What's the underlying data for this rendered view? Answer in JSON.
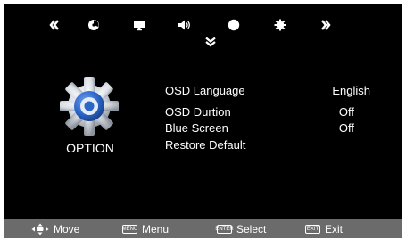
{
  "top_nav": {
    "items": [
      {
        "icon": "chevron-double-left-icon"
      },
      {
        "icon": "picture-mode-icon"
      },
      {
        "icon": "screen-icon"
      },
      {
        "icon": "speaker-icon"
      },
      {
        "icon": "circle-icon"
      },
      {
        "icon": "gear-icon"
      },
      {
        "icon": "chevron-double-right-icon"
      }
    ],
    "down_indicator_icon": "chevron-double-down-icon"
  },
  "category": {
    "label": "OPTION",
    "icon": "gear-icon",
    "icon_color": "#2b66c9"
  },
  "menu": {
    "items": [
      {
        "label": "OSD Language",
        "value": "English"
      },
      {
        "label": "OSD Durtion",
        "value": "Off"
      },
      {
        "label": "Blue Screen",
        "value": "Off"
      },
      {
        "label": "Restore Default",
        "value": ""
      }
    ]
  },
  "bottom_bar": {
    "hints": [
      {
        "key": "",
        "label": "Move",
        "icon": "dpad-icon"
      },
      {
        "key": "MENU",
        "label": "Menu"
      },
      {
        "key": "ENTER",
        "label": "Select"
      },
      {
        "key": "EXIT",
        "label": "Exit"
      }
    ]
  },
  "colors": {
    "background": "#000000",
    "text": "#ffffff",
    "bottom_bar": "#6b6b6b",
    "accent_blue": "#2b66c9"
  }
}
